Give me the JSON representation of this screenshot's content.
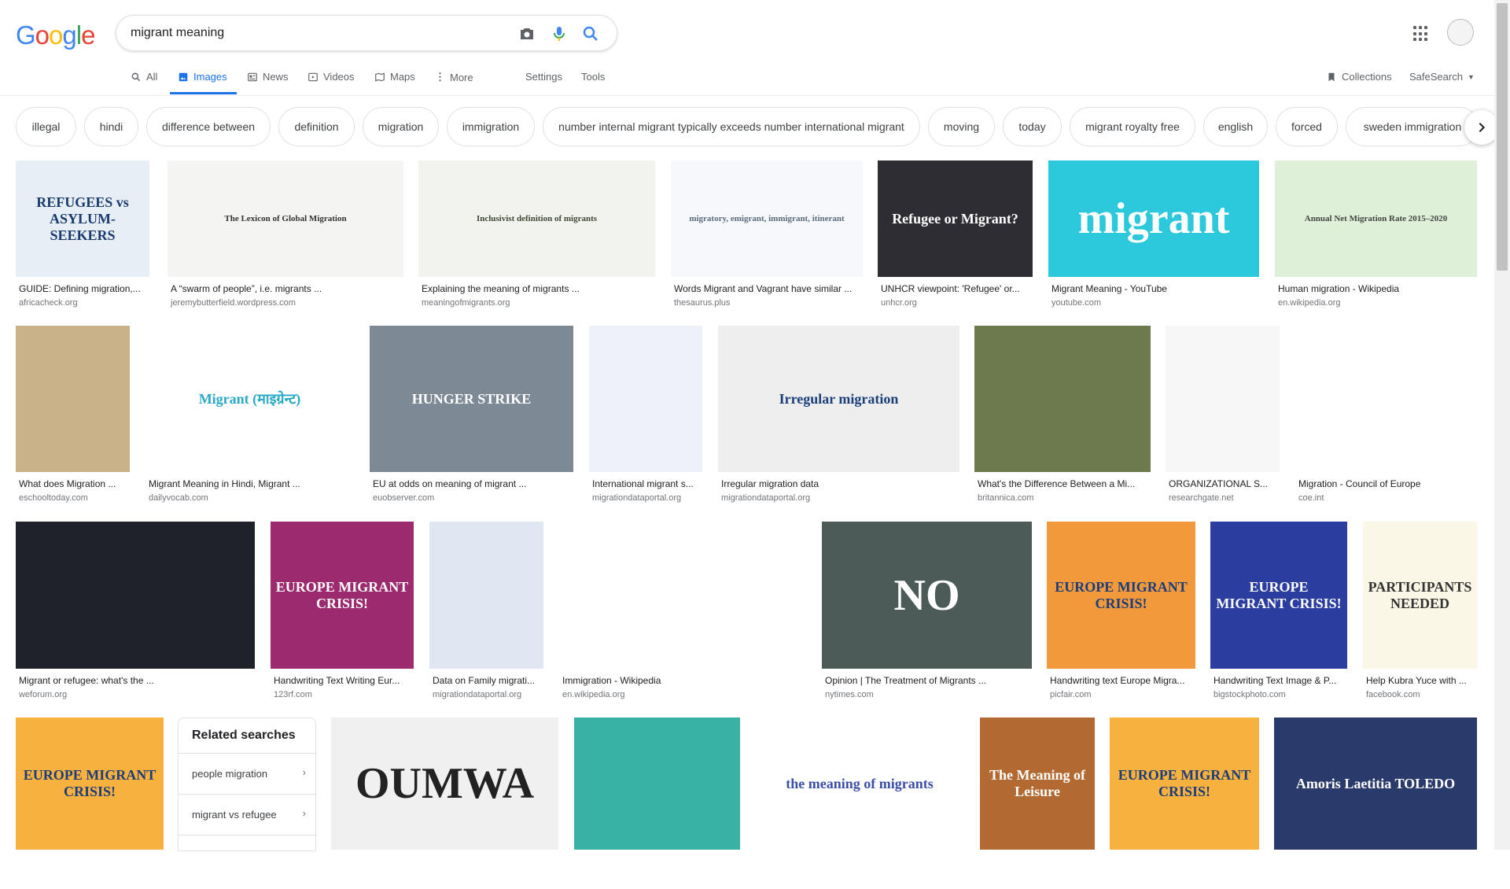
{
  "header": {
    "logo": "Google",
    "query": "migrant meaning"
  },
  "tabs": [
    {
      "label": "All",
      "icon": "search-icon"
    },
    {
      "label": "Images",
      "icon": "image-icon"
    },
    {
      "label": "News",
      "icon": "news-icon"
    },
    {
      "label": "Videos",
      "icon": "video-icon"
    },
    {
      "label": "Maps",
      "icon": "map-icon"
    },
    {
      "label": "More",
      "icon": "more-vert-icon"
    },
    {
      "label": "Settings"
    },
    {
      "label": "Tools"
    }
  ],
  "right_tools": {
    "collections": "Collections",
    "safesearch": "SafeSearch"
  },
  "chips": [
    "illegal",
    "hindi",
    "difference between",
    "definition",
    "migration",
    "immigration",
    "number internal migrant typically exceeds number international migrant",
    "moving",
    "today",
    "migrant royalty free",
    "english",
    "forced",
    "sweden immigration"
  ],
  "results": [
    {
      "title": "GUIDE: Defining migration,...",
      "site": "africacheck.org",
      "thumb_text": "REFUGEES vs ASYLUM-SEEKERS",
      "bg": "#e8eef5",
      "fg": "#1a3b6e"
    },
    {
      "title": "A “swarm of people”, i.e. migrants ...",
      "site": "jeremybutterfield.wordpress.com",
      "thumb_text": "The Lexicon of Global Migration",
      "bg": "#f4f4f2",
      "fg": "#333333"
    },
    {
      "title": "Explaining the meaning of migrants ...",
      "site": "meaningofmigrants.org",
      "thumb_text": "Inclusivist definition of migrants",
      "bg": "#f2f2ef",
      "fg": "#3d4a33"
    },
    {
      "title": "Words Migrant and Vagrant have similar ...",
      "site": "thesaurus.plus",
      "thumb_text": "migratory, emigrant, immigrant, itinerant",
      "bg": "#f6f8fb",
      "fg": "#5a6b7d"
    },
    {
      "title": "UNHCR viewpoint: 'Refugee' or...",
      "site": "unhcr.org",
      "thumb_text": "Refugee or Migrant?",
      "bg": "#2e2d33",
      "fg": "#ffffff"
    },
    {
      "title": "Migrant Meaning - YouTube",
      "site": "youtube.com",
      "thumb_text": "migrant",
      "bg": "#2cc9dc",
      "fg": "#ffffff"
    },
    {
      "title": "Human migration - Wikipedia",
      "site": "en.wikipedia.org",
      "thumb_text": "Annual Net Migration Rate 2015–2020",
      "bg": "#dff0d8",
      "fg": "#444444"
    },
    {
      "title": "What does Migration ...",
      "site": "eschooltoday.com",
      "thumb_text": "",
      "bg": "#c9b28a",
      "fg": "#333333"
    },
    {
      "title": "Migrant Meaning in Hindi, Migrant ...",
      "site": "dailyvocab.com",
      "thumb_text": "Migrant (माइग्रेन्ट)",
      "bg": "#ffffff",
      "fg": "#2aa9c8"
    },
    {
      "title": "EU at odds on meaning of migrant ...",
      "site": "euobserver.com",
      "thumb_text": "HUNGER STRIKE",
      "bg": "#7d8a96",
      "fg": "#ffffff"
    },
    {
      "title": "International migrant s...",
      "site": "migrationdataportal.org",
      "thumb_text": "",
      "bg": "#eef2f8",
      "fg": "#3a66b0"
    },
    {
      "title": "Irregular migration data",
      "site": "migrationdataportal.org",
      "thumb_text": "Irregular migration",
      "bg": "#eeeeee",
      "fg": "#1c3f7a"
    },
    {
      "title": "What's the Difference Between a Mi...",
      "site": "britannica.com",
      "thumb_text": "",
      "bg": "#6c7a4e",
      "fg": "#ffffff"
    },
    {
      "title": "ORGANIZATIONAL S...",
      "site": "researchgate.net",
      "thumb_text": "",
      "bg": "#f7f7f7",
      "fg": "#555555"
    },
    {
      "title": "Migration - Council of Europe",
      "site": "coe.int",
      "thumb_text": "",
      "bg": "#ffffff",
      "fg": "#222222"
    },
    {
      "title": "Migrant or refugee: what's the ...",
      "site": "weforum.org",
      "thumb_text": "",
      "bg": "#1f2228",
      "fg": "#ffffff"
    },
    {
      "title": "Handwriting Text Writing Eur...",
      "site": "123rf.com",
      "thumb_text": "EUROPE MIGRANT CRISIS!",
      "bg": "#9b2a6e",
      "fg": "#ffffff"
    },
    {
      "title": "Data on Family migrati...",
      "site": "migrationdataportal.org",
      "thumb_text": "",
      "bg": "#dfe7f3",
      "fg": "#2c5aa0"
    },
    {
      "title": "Immigration - Wikipedia",
      "site": "en.wikipedia.org",
      "thumb_text": "",
      "bg": "#ffffff",
      "fg": "#333333"
    },
    {
      "title": "Opinion | The Treatment of Migrants ...",
      "site": "nytimes.com",
      "thumb_text": "NO",
      "bg": "#4d5b58",
      "fg": "#ffffff"
    },
    {
      "title": "Handwriting text Europe Migra...",
      "site": "picfair.com",
      "thumb_text": "EUROPE MIGRANT CRISIS!",
      "bg": "#f29a3b",
      "fg": "#1d3c7a"
    },
    {
      "title": "Handwriting Text Image & P...",
      "site": "bigstockphoto.com",
      "thumb_text": "EUROPE MIGRANT CRISIS!",
      "bg": "#2b3ea0",
      "fg": "#ffffff"
    },
    {
      "title": "Help Kubra Yuce with ...",
      "site": "facebook.com",
      "thumb_text": "PARTICIPANTS NEEDED",
      "bg": "#fbf7e6",
      "fg": "#333333"
    },
    {
      "title": "",
      "site": "",
      "thumb_text": "EUROPE MIGRANT CRISIS!",
      "bg": "#f6b13f",
      "fg": "#1d3c7a"
    },
    {
      "title": "",
      "site": "",
      "thumb_text": "OUMWA",
      "bg": "#f0f0f0",
      "fg": "#222222"
    },
    {
      "title": "",
      "site": "",
      "thumb_text": "",
      "bg": "#39b2a6",
      "fg": "#ffffff"
    },
    {
      "title": "",
      "site": "",
      "thumb_text": "the meaning of migrants",
      "bg": "#ffffff",
      "fg": "#3b4fa8"
    },
    {
      "title": "",
      "site": "",
      "thumb_text": "The Meaning of Leisure",
      "bg": "#b36a32",
      "fg": "#ffffff"
    },
    {
      "title": "",
      "site": "",
      "thumb_text": "EUROPE MIGRANT CRISIS!",
      "bg": "#f6b13f",
      "fg": "#1d3c7a"
    },
    {
      "title": "",
      "site": "",
      "thumb_text": "Amoris Laetitia TOLEDO",
      "bg": "#2a3b6b",
      "fg": "#ffffff"
    }
  ],
  "related": {
    "heading": "Related searches",
    "items": [
      "people migration",
      "migrant vs refugee"
    ]
  }
}
